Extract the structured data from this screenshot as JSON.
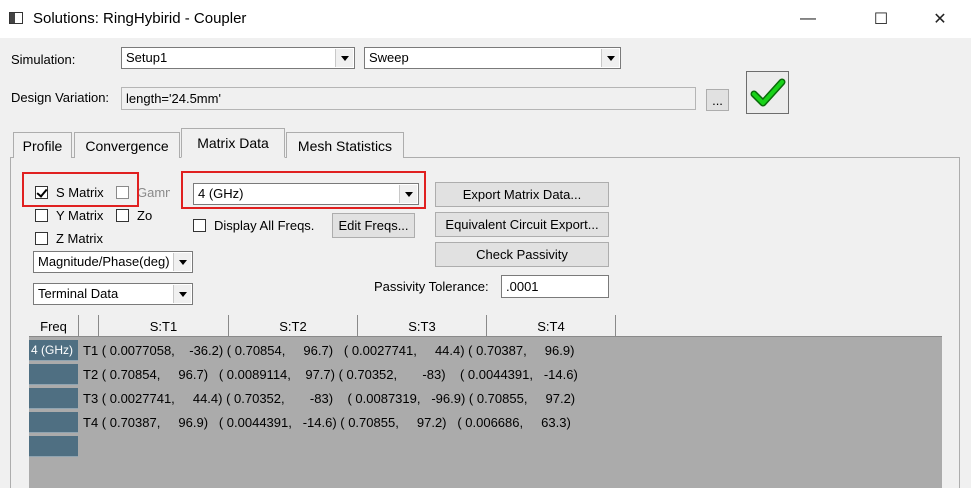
{
  "window": {
    "title": "Solutions: RingHybirid - Coupler",
    "minimize_glyph": "—",
    "maximize_glyph": "☐",
    "close_glyph": "✕"
  },
  "simulation": {
    "label": "Simulation:",
    "setup_value": "Setup1",
    "sweep_value": "Sweep"
  },
  "design_variation": {
    "label": "Design Variation:",
    "value": "length='24.5mm'",
    "browse_label": "..."
  },
  "apply_icon": "green-checkmark-icon",
  "tabs": [
    {
      "label": "Profile",
      "active": false
    },
    {
      "label": "Convergence",
      "active": false
    },
    {
      "label": "Matrix Data",
      "active": true
    },
    {
      "label": "Mesh Statistics",
      "active": false
    }
  ],
  "options": {
    "s_matrix": {
      "label": "S Matrix",
      "checked": true
    },
    "gamma": {
      "label": "Gamma",
      "checked": false
    },
    "y_matrix": {
      "label": "Y Matrix",
      "checked": false
    },
    "zo": {
      "label": "Zo",
      "checked": false
    },
    "z_matrix": {
      "label": "Z Matrix",
      "checked": false
    },
    "format_value": "Magnitude/Phase(deg)",
    "data_type_value": "Terminal Data",
    "freq_value": "4 (GHz)",
    "display_all_freqs": {
      "label": "Display All Freqs.",
      "checked": false
    },
    "edit_freqs_label": "Edit Freqs...",
    "export_matrix_label": "Export Matrix Data...",
    "equiv_circuit_label": "Equivalent Circuit Export...",
    "check_passivity_label": "Check Passivity",
    "passivity_tolerance_label": "Passivity Tolerance:",
    "passivity_tolerance_value": ".0001"
  },
  "table": {
    "headers": [
      "Freq",
      "",
      "S:T1",
      "S:T2",
      "S:T3",
      "S:T4"
    ],
    "freq": "4 (GHz)",
    "rows": [
      "T1 ( 0.0077058,    -36.2) ( 0.70854,     96.7)   ( 0.0027741,     44.4) ( 0.70387,     96.9)",
      "T2 ( 0.70854,     96.7)   ( 0.0089114,    97.7) ( 0.70352,       -83)    ( 0.0044391,   -14.6)",
      "T3 ( 0.0027741,     44.4) ( 0.70352,       -83)    ( 0.0087319,   -96.9) ( 0.70855,     97.2)",
      "T4 ( 0.70387,     96.9)   ( 0.0044391,   -14.6) ( 0.70855,     97.2)   ( 0.006686,     63.3)"
    ]
  }
}
